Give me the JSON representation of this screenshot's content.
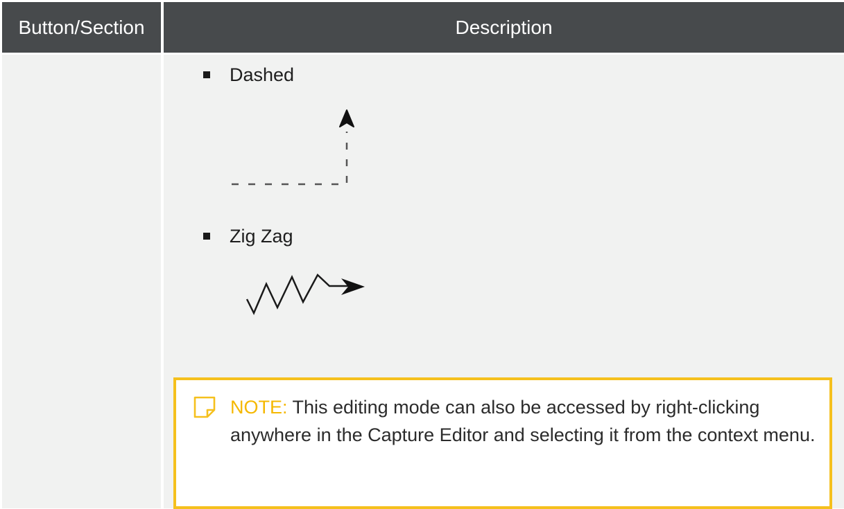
{
  "table": {
    "headers": [
      "Button/Section",
      "Description"
    ]
  },
  "items": [
    {
      "label": "Dashed",
      "style": "dashed-arrow"
    },
    {
      "label": "Zig Zag",
      "style": "zigzag-arrow"
    }
  ],
  "note": {
    "label": "NOTE:",
    "text": " This editing mode can also be accessed by right-clicking anywhere in the Capture Editor and selecting it from the context menu.",
    "icon": "sticky-note-icon"
  },
  "colors": {
    "header_bg": "#474a4c",
    "cell_bg": "#f1f2f1",
    "note_accent": "#f5c01d"
  }
}
